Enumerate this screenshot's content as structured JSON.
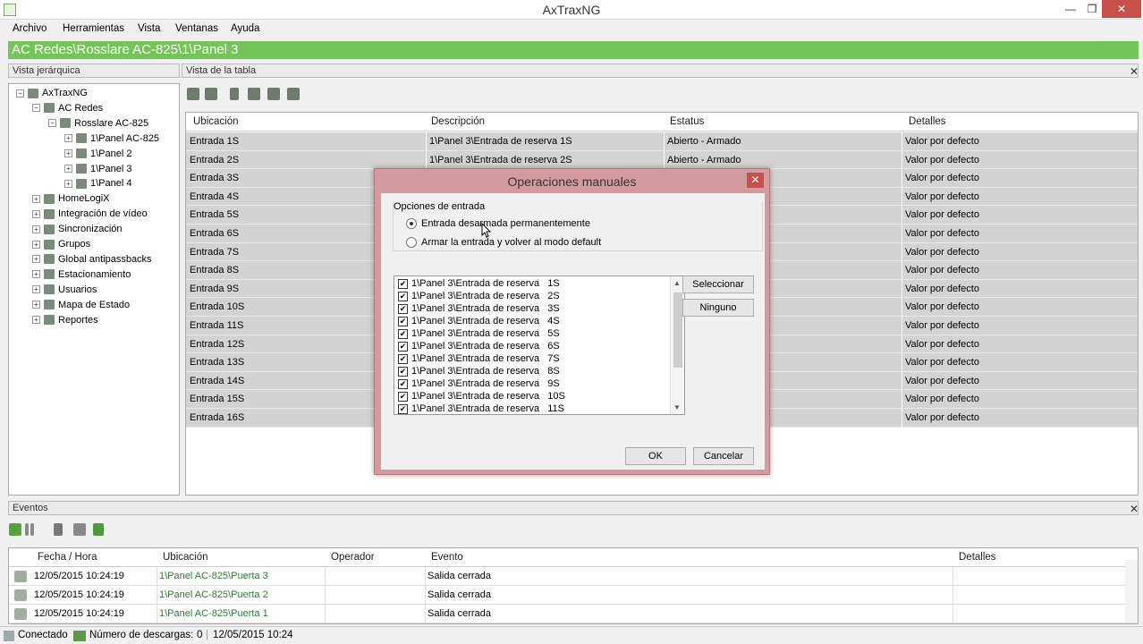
{
  "window": {
    "title": "AxTraxNG"
  },
  "menu": [
    "Archivo",
    "Herramientas",
    "Vista",
    "Ventanas",
    "Ayuda"
  ],
  "breadcrumb": "AC Redes\\Rosslare AC-825\\1\\Panel 3",
  "panels": {
    "tree_title": "Vista jerárquica",
    "table_title": "Vista de la tabla",
    "events_title": "Eventos"
  },
  "tree": [
    {
      "label": "AxTraxNG",
      "level": 0,
      "expander": "minus",
      "icon": "app-icon"
    },
    {
      "label": "AC Redes",
      "level": 1,
      "expander": "minus",
      "icon": "network-icon"
    },
    {
      "label": "Rosslare AC-825",
      "level": 2,
      "expander": "minus",
      "icon": "network-icon"
    },
    {
      "label": "1\\Panel  AC-825",
      "level": 3,
      "expander": "plus",
      "icon": "panel-icon"
    },
    {
      "label": "1\\Panel 2",
      "level": 3,
      "expander": "plus",
      "icon": "panel-icon"
    },
    {
      "label": "1\\Panel 3",
      "level": 3,
      "expander": "plus",
      "icon": "panel-icon"
    },
    {
      "label": "1\\Panel 4",
      "level": 3,
      "expander": "plus",
      "icon": "panel-icon"
    },
    {
      "label": "HomeLogiX",
      "level": 1,
      "expander": "plus",
      "icon": "homelogix-icon"
    },
    {
      "label": "Integración de vídeo",
      "level": 1,
      "expander": "plus",
      "icon": "video-icon"
    },
    {
      "label": "Sincronización",
      "level": 1,
      "expander": "plus",
      "icon": "sync-icon"
    },
    {
      "label": "Grupos",
      "level": 1,
      "expander": "plus",
      "icon": "groups-icon"
    },
    {
      "label": "Global antipassbacks",
      "level": 1,
      "expander": "plus",
      "icon": "antipassback-icon"
    },
    {
      "label": "Estacionamiento",
      "level": 1,
      "expander": "plus",
      "icon": "parking-icon"
    },
    {
      "label": "Usuarios",
      "level": 1,
      "expander": "plus",
      "icon": "users-icon"
    },
    {
      "label": "Mapa de Estado",
      "level": 1,
      "expander": "plus",
      "icon": "map-icon"
    },
    {
      "label": "Reportes",
      "level": 1,
      "expander": "plus",
      "icon": "reports-icon"
    }
  ],
  "table": {
    "headers": [
      "Ubicación",
      "Descripción",
      "Estatus",
      "Detalles"
    ],
    "rows": [
      [
        "Entrada 1S",
        "1\\Panel 3\\Entrada de reserva   1S",
        "Abierto - Armado",
        "Valor por defecto"
      ],
      [
        "Entrada 2S",
        "1\\Panel 3\\Entrada de reserva   2S",
        "Abierto - Armado",
        "Valor por defecto"
      ],
      [
        "Entrada 3S",
        "",
        "",
        "Valor por defecto"
      ],
      [
        "Entrada 4S",
        "",
        "",
        "Valor por defecto"
      ],
      [
        "Entrada 5S",
        "",
        "",
        "Valor por defecto"
      ],
      [
        "Entrada 6S",
        "",
        "",
        "Valor por defecto"
      ],
      [
        "Entrada 7S",
        "",
        "",
        "Valor por defecto"
      ],
      [
        "Entrada 8S",
        "",
        "",
        "Valor por defecto"
      ],
      [
        "Entrada 9S",
        "",
        "",
        "Valor por defecto"
      ],
      [
        "Entrada 10S",
        "",
        "",
        "Valor por defecto"
      ],
      [
        "Entrada 11S",
        "",
        "",
        "Valor por defecto"
      ],
      [
        "Entrada 12S",
        "",
        "",
        "Valor por defecto"
      ],
      [
        "Entrada 13S",
        "",
        "",
        "Valor por defecto"
      ],
      [
        "Entrada 14S",
        "",
        "",
        "Valor por defecto"
      ],
      [
        "Entrada 15S",
        "",
        "",
        "Valor por defecto"
      ],
      [
        "Entrada 16S",
        "",
        "",
        "Valor por defecto"
      ]
    ]
  },
  "dialog": {
    "title": "Operaciones manuales",
    "group_label": "Opciones de entrada",
    "options": [
      {
        "label": "Entrada desarmada permanentemente",
        "selected": true
      },
      {
        "label": "Armar la entrada y volver al modo default",
        "selected": false
      }
    ],
    "list": [
      "1\\Panel 3\\Entrada de reserva   1S",
      "1\\Panel 3\\Entrada de reserva   2S",
      "1\\Panel 3\\Entrada de reserva   3S",
      "1\\Panel 3\\Entrada de reserva   4S",
      "1\\Panel 3\\Entrada de reserva   5S",
      "1\\Panel 3\\Entrada de reserva   6S",
      "1\\Panel 3\\Entrada de reserva   7S",
      "1\\Panel 3\\Entrada de reserva   8S",
      "1\\Panel 3\\Entrada de reserva   9S",
      "1\\Panel 3\\Entrada de reserva   10S",
      "1\\Panel 3\\Entrada de reserva   11S"
    ],
    "select_all": "Seleccionar",
    "select_none": "Ninguno",
    "ok": "OK",
    "cancel": "Cancelar"
  },
  "events": {
    "headers": [
      "Fecha / Hora",
      "Ubicación",
      "Operador",
      "Evento",
      "Detalles"
    ],
    "rows": [
      [
        "12/05/2015 10:24:19",
        "1\\Panel  AC-825\\Puerta   3",
        "",
        "Salida cerrada",
        ""
      ],
      [
        "12/05/2015 10:24:19",
        "1\\Panel  AC-825\\Puerta   2",
        "",
        "Salida cerrada",
        ""
      ],
      [
        "12/05/2015 10:24:19",
        "1\\Panel  AC-825\\Puerta   1",
        "",
        "Salida cerrada",
        ""
      ]
    ]
  },
  "status": {
    "connection": "Conectado",
    "downloads_label": "Número de descargas:",
    "downloads": "0",
    "timestamp": "12/05/2015 10:24"
  },
  "colors": {
    "accent_green": "#73c557",
    "dialog_frame": "#d49b9f",
    "selected_row": "#d3d3d3"
  }
}
